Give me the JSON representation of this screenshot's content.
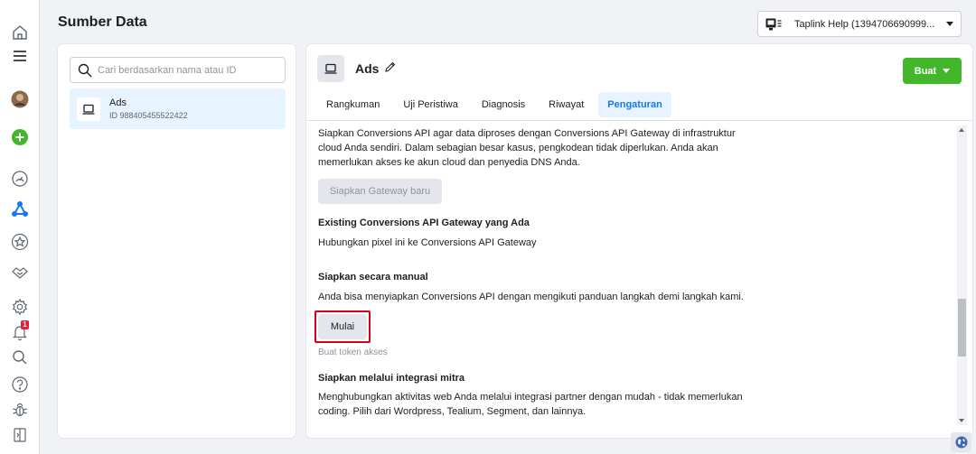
{
  "header": {
    "title": "Sumber Data"
  },
  "account": {
    "label": "Taplink Help (1394706690999..."
  },
  "sidebar": {
    "notification_count": "1"
  },
  "search": {
    "placeholder": "Cari berdasarkan nama atau ID"
  },
  "sources": [
    {
      "name": "Ads",
      "id": "ID 988405455522422"
    }
  ],
  "datasource": {
    "name": "Ads",
    "create_label": "Buat"
  },
  "tabs": [
    {
      "label": "Rangkuman"
    },
    {
      "label": "Uji Peristiwa"
    },
    {
      "label": "Diagnosis"
    },
    {
      "label": "Riwayat"
    },
    {
      "label": "Pengaturan"
    }
  ],
  "active_tab": "Pengaturan",
  "content": {
    "intro": "Siapkan Conversions API agar data diproses dengan Conversions API Gateway di infrastruktur cloud Anda sendiri. Dalam sebagian besar kasus, pengkodean tidak diperlukan. Anda akan memerlukan akses ke akun cloud dan penyedia DNS Anda.",
    "gateway_button": "Siapkan Gateway baru",
    "existing_title": "Existing Conversions API Gateway yang Ada",
    "existing_desc": "Hubungkan pixel ini ke Conversions API Gateway",
    "manual_title": "Siapkan secara manual",
    "manual_desc": "Anda bisa menyiapkan Conversions API dengan mengikuti panduan langkah demi langkah kami.",
    "start_button": "Mulai",
    "token_hint": "Buat token akses",
    "partner_title": "Siapkan melalui integrasi mitra",
    "partner_desc": "Menghubungkan aktivitas web Anda melalui integrasi partner dengan mudah - tidak memerlukan coding. Pilih dari Wordpress, Tealium, Segment, dan lainnya."
  },
  "colors": {
    "accent": "#1877f2",
    "create": "#42b72a",
    "highlight": "#d0021b"
  },
  "icons": [
    "home-icon",
    "menu-icon",
    "avatar",
    "add-icon",
    "gauge-icon",
    "events-manager-icon",
    "star-icon",
    "handshake-icon",
    "settings-icon",
    "bell-icon",
    "search-icon",
    "help-icon",
    "bug-icon",
    "panel-icon",
    "monitor-icon",
    "pencil-icon",
    "globe-icon"
  ]
}
